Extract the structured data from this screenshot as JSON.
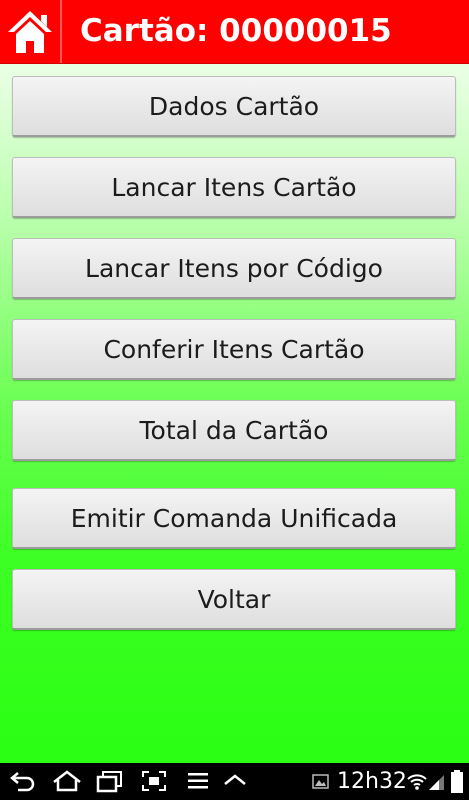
{
  "header": {
    "title": "Cartão: 00000015",
    "home_icon": "home-icon",
    "color": "#fe0000"
  },
  "menu": {
    "buttons": [
      {
        "label": "Dados Cartão"
      },
      {
        "label": "Lancar Itens Cartão"
      },
      {
        "label": "Lancar Itens por Código"
      },
      {
        "label": "Conferir Itens Cartão"
      },
      {
        "label": "Total da Cartão"
      },
      {
        "label": "Emitir Comanda Unificada"
      },
      {
        "label": "Voltar"
      }
    ]
  },
  "status_bar": {
    "time": "12h32",
    "icons": [
      "back-icon",
      "home-icon",
      "recent-apps-icon",
      "screenshot-icon",
      "menu-icon",
      "chevron-up-icon",
      "image-notification-icon",
      "wifi-icon",
      "signal-icon",
      "battery-icon"
    ]
  }
}
